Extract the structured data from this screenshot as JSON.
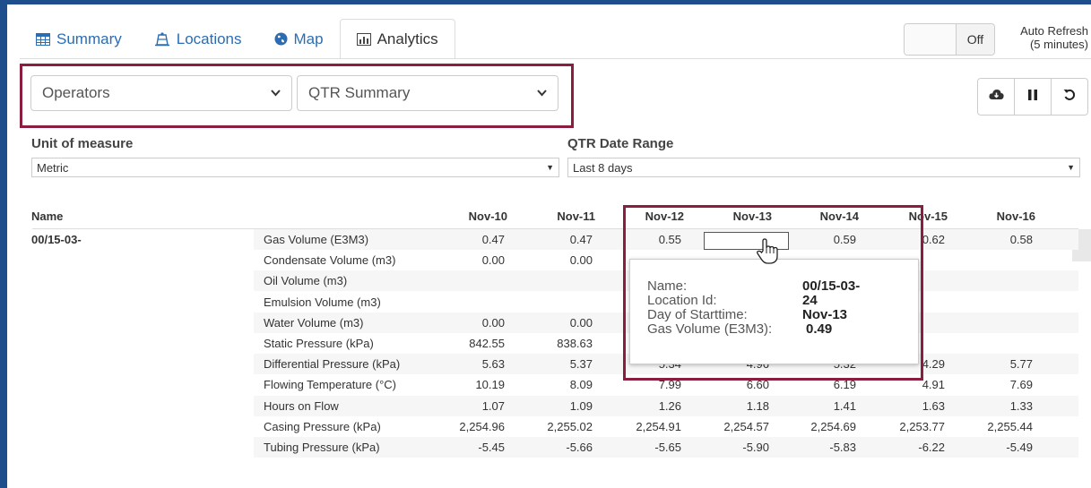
{
  "tabs": [
    {
      "label": "Summary",
      "icon": "table-icon"
    },
    {
      "label": "Locations",
      "icon": "locations-icon"
    },
    {
      "label": "Map",
      "icon": "globe-icon"
    },
    {
      "label": "Analytics",
      "icon": "bar-chart-icon",
      "active": true
    }
  ],
  "auto_refresh": {
    "toggle_label": "Off",
    "label_line1": "Auto Refresh",
    "label_line2": "(5 minutes)"
  },
  "selectors": {
    "group": "Operators",
    "report": "QTR Summary"
  },
  "actions": [
    {
      "icon": "cloud-download-icon"
    },
    {
      "icon": "pause-icon"
    },
    {
      "icon": "refresh-icon"
    }
  ],
  "unit_of_measure": {
    "label": "Unit of measure",
    "value": "Metric"
  },
  "date_range": {
    "label": "QTR Date Range",
    "value": "Last 8 days"
  },
  "table": {
    "name_header": "Name",
    "columns": [
      "Nov-10",
      "Nov-11",
      "Nov-12",
      "Nov-13",
      "Nov-14",
      "Nov-15",
      "Nov-16"
    ],
    "name": "00/15-03-",
    "rows": [
      {
        "label": "Gas Volume (E3M3)",
        "values": [
          "0.47",
          "0.47",
          "0.55",
          "0.49",
          "0.59",
          "0.62",
          "0.58"
        ]
      },
      {
        "label": "Condensate Volume (m3)",
        "values": [
          "0.00",
          "0.00",
          "",
          "",
          "",
          "",
          ""
        ]
      },
      {
        "label": "Oil Volume (m3)",
        "values": [
          "",
          "",
          "",
          "",
          "",
          "",
          ""
        ]
      },
      {
        "label": "Emulsion Volume (m3)",
        "values": [
          "",
          "",
          "",
          "",
          "",
          "",
          ""
        ]
      },
      {
        "label": "Water Volume (m3)",
        "values": [
          "0.00",
          "0.00",
          "",
          "",
          "",
          "",
          ""
        ]
      },
      {
        "label": "Static Pressure (kPa)",
        "values": [
          "842.55",
          "838.63",
          "",
          "",
          "",
          "",
          ""
        ]
      },
      {
        "label": "Differential Pressure (kPa)",
        "values": [
          "5.63",
          "5.37",
          "5.34",
          "4.96",
          "5.32",
          "4.29",
          "5.77"
        ]
      },
      {
        "label": "Flowing Temperature (°C)",
        "values": [
          "10.19",
          "8.09",
          "7.99",
          "6.60",
          "6.19",
          "4.91",
          "7.69"
        ]
      },
      {
        "label": "Hours on Flow",
        "values": [
          "1.07",
          "1.09",
          "1.26",
          "1.18",
          "1.41",
          "1.63",
          "1.33"
        ]
      },
      {
        "label": "Casing Pressure (kPa)",
        "values": [
          "2,254.96",
          "2,255.02",
          "2,254.91",
          "2,254.57",
          "2,254.69",
          "2,253.77",
          "2,255.44"
        ]
      },
      {
        "label": "Tubing Pressure (kPa)",
        "values": [
          "-5.45",
          "-5.66",
          "-5.65",
          "-5.90",
          "-5.83",
          "-6.22",
          "-5.49"
        ]
      }
    ]
  },
  "tooltip": {
    "rows": [
      {
        "key": "Name:",
        "value": "00/15-03-"
      },
      {
        "key": "Location Id:",
        "value": "24"
      },
      {
        "key": "Day of Starttime:",
        "value": "Nov-13"
      },
      {
        "key": "Gas Volume (E3M3):",
        "value": "0.49"
      }
    ]
  },
  "colors": {
    "frame": "#1f4e8c",
    "highlight": "#8b1e3f",
    "link": "#2a6db5"
  }
}
